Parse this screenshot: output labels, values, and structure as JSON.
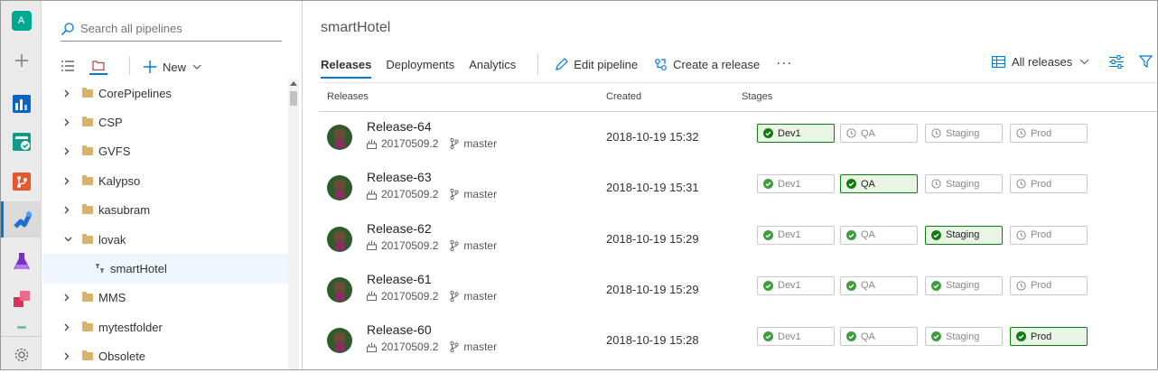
{
  "rail": {
    "avatar_letter": "A",
    "items": [
      {
        "name": "add-icon"
      },
      {
        "name": "boards-icon"
      },
      {
        "name": "test-plans-board-icon"
      },
      {
        "name": "repos-icon"
      },
      {
        "name": "pipelines-icon"
      },
      {
        "name": "test-plans-icon"
      },
      {
        "name": "artifacts-icon"
      },
      {
        "name": "settings-icon"
      }
    ]
  },
  "tree": {
    "search_placeholder": "Search all pipelines",
    "new_label": "New",
    "items": [
      {
        "label": "CorePipelines",
        "type": "folder",
        "expanded": false
      },
      {
        "label": "CSP",
        "type": "folder",
        "expanded": false
      },
      {
        "label": "GVFS",
        "type": "folder",
        "expanded": false
      },
      {
        "label": "Kalypso",
        "type": "folder",
        "expanded": false
      },
      {
        "label": "kasubram",
        "type": "folder",
        "expanded": false
      },
      {
        "label": "lovak",
        "type": "folder",
        "expanded": true
      },
      {
        "label": "smartHotel",
        "type": "pipeline",
        "selected": true
      },
      {
        "label": "MMS",
        "type": "folder",
        "expanded": false
      },
      {
        "label": "mytestfolder",
        "type": "folder",
        "expanded": false
      },
      {
        "label": "Obsolete",
        "type": "folder",
        "expanded": false
      }
    ]
  },
  "main": {
    "title": "smartHotel",
    "tabs": [
      {
        "label": "Releases",
        "active": true
      },
      {
        "label": "Deployments",
        "active": false
      },
      {
        "label": "Analytics",
        "active": false
      }
    ],
    "actions": {
      "edit_pipeline": "Edit pipeline",
      "create_release": "Create a release",
      "more": "···"
    },
    "view_selector": "All releases",
    "columns": {
      "releases": "Releases",
      "created": "Created",
      "stages": "Stages"
    },
    "releases": [
      {
        "name": "Release-64",
        "build": "20170509.2",
        "branch": "master",
        "created": "2018-10-19 15:32",
        "stages": [
          {
            "label": "Dev1",
            "status": "success"
          },
          {
            "label": "QA",
            "status": "pending"
          },
          {
            "label": "Staging",
            "status": "pending"
          },
          {
            "label": "Prod",
            "status": "pending"
          }
        ]
      },
      {
        "name": "Release-63",
        "build": "20170509.2",
        "branch": "master",
        "created": "2018-10-19 15:31",
        "stages": [
          {
            "label": "Dev1",
            "status": "inactive"
          },
          {
            "label": "QA",
            "status": "success"
          },
          {
            "label": "Staging",
            "status": "pending"
          },
          {
            "label": "Prod",
            "status": "pending"
          }
        ]
      },
      {
        "name": "Release-62",
        "build": "20170509.2",
        "branch": "master",
        "created": "2018-10-19 15:29",
        "stages": [
          {
            "label": "Dev1",
            "status": "inactive"
          },
          {
            "label": "QA",
            "status": "inactive"
          },
          {
            "label": "Staging",
            "status": "success"
          },
          {
            "label": "Prod",
            "status": "pending"
          }
        ]
      },
      {
        "name": "Release-61",
        "build": "20170509.2",
        "branch": "master",
        "created": "2018-10-19 15:29",
        "stages": [
          {
            "label": "Dev1",
            "status": "inactive"
          },
          {
            "label": "QA",
            "status": "inactive"
          },
          {
            "label": "Staging",
            "status": "inactive"
          },
          {
            "label": "Prod",
            "status": "pending"
          }
        ]
      },
      {
        "name": "Release-60",
        "build": "20170509.2",
        "branch": "master",
        "created": "2018-10-19 15:28",
        "stages": [
          {
            "label": "Dev1",
            "status": "inactive"
          },
          {
            "label": "QA",
            "status": "inactive"
          },
          {
            "label": "Staging",
            "status": "inactive"
          },
          {
            "label": "Prod",
            "status": "success"
          }
        ]
      }
    ]
  },
  "colors": {
    "accent": "#0078d4",
    "success": "#107c10",
    "success_bg": "#e8f5e5",
    "folder": "#d8b26b"
  }
}
